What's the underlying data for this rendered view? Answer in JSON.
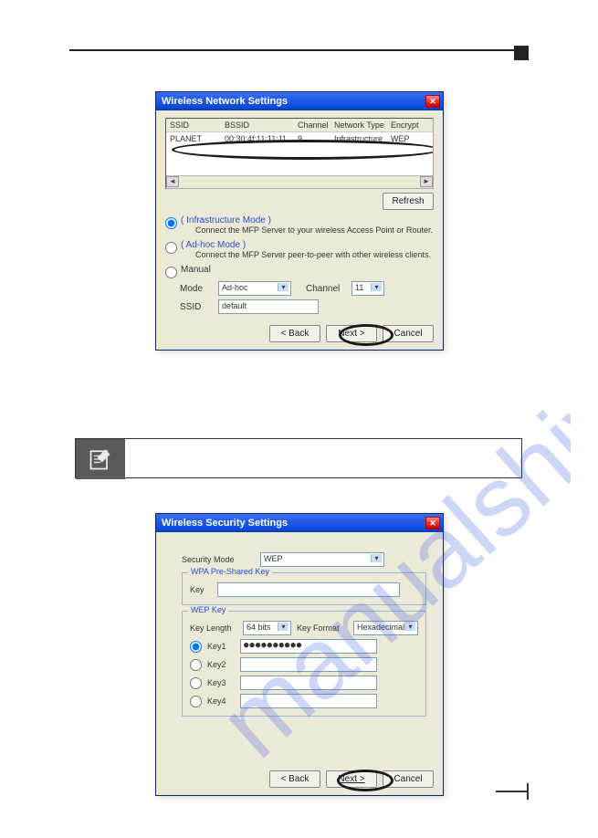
{
  "window1": {
    "title": "Wireless Network Settings",
    "headers": {
      "ssid": "SSID",
      "bssid": "BSSID",
      "channel": "Channel",
      "nettype": "Network Type",
      "encrypt": "Encrypt"
    },
    "row": {
      "ssid": "PLANET",
      "bssid": "00:30:4f:11:11:11",
      "channel": "9",
      "nettype": "Infrastructure",
      "encrypt": "WEP"
    },
    "refresh": "Refresh",
    "infra_label": "( Infrastructure Mode )",
    "infra_desc": "Connect the MFP Server to your wireless Access Point or Router.",
    "adhoc_label": "( Ad-hoc Mode )",
    "adhoc_desc": "Connect the MFP Server peer-to-peer with other wireless clients.",
    "manual_label": "Manual",
    "mode_label": "Mode",
    "mode_value": "Ad-hoc",
    "channel_label": "Channel",
    "channel_value": "11",
    "ssid_label": "SSID",
    "ssid_value": "default",
    "back": "< Back",
    "next": "Next >",
    "cancel": "Cancel"
  },
  "window2": {
    "title": "Wireless Security Settings",
    "secmode_label": "Security Mode",
    "secmode_value": "WEP",
    "psk_legend": "WPA Pre-Shared Key",
    "psk_key_label": "Key",
    "psk_key_value": "",
    "wep_legend": "WEP Key",
    "keylen_label": "Key Length",
    "keylen_value": "64 bits",
    "keyfmt_label": "Key Format",
    "keyfmt_value": "Hexadecimal",
    "key1_label": "Key1",
    "key1_value": "●●●●●●●●●●",
    "key2_label": "Key2",
    "key3_label": "Key3",
    "key4_label": "Key4",
    "back": "< Back",
    "next": "Next >",
    "cancel": "Cancel"
  }
}
